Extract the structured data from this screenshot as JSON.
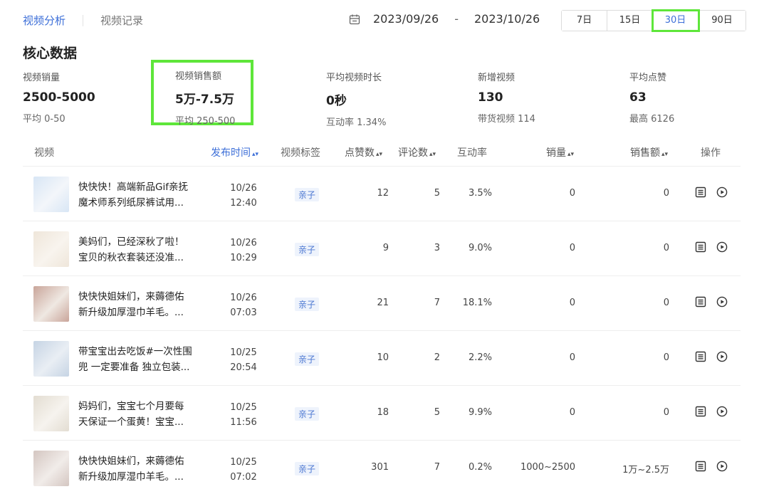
{
  "tabs": [
    {
      "label": "视频分析",
      "active": true
    },
    {
      "label": "视频记录",
      "active": false
    }
  ],
  "date_range": {
    "start": "2023/09/26",
    "separator": "-",
    "end": "2023/10/26"
  },
  "range_buttons": [
    {
      "label": "7日",
      "active": false
    },
    {
      "label": "15日",
      "active": false
    },
    {
      "label": "30日",
      "active": true
    },
    {
      "label": "90日",
      "active": false
    }
  ],
  "section_title": "核心数据",
  "metrics": [
    {
      "label": "视频销量",
      "value": "2500-5000",
      "sub": "平均 0-50"
    },
    {
      "label": "视频销售额",
      "value": "5万-7.5万",
      "sub": "平均 250-500"
    },
    {
      "label": "平均视频时长",
      "value": "0秒",
      "sub": "互动率 1.34%"
    },
    {
      "label": "新增视频",
      "value": "130",
      "sub": "带货视频 114"
    },
    {
      "label": "平均点赞",
      "value": "63",
      "sub": "最高 6126"
    }
  ],
  "table": {
    "headers": {
      "video": "视频",
      "publish_time": "发布时间",
      "tag": "视频标签",
      "likes": "点赞数",
      "comments": "评论数",
      "engagement": "互动率",
      "sales": "销量",
      "revenue": "销售额",
      "actions": "操作"
    },
    "rows": [
      {
        "title1": "快快快！高端新品Gif亲抚",
        "title2": "魔术师系列纸尿裤试用...",
        "date": "10/26",
        "time": "12:40",
        "tag": "亲子",
        "likes": "12",
        "comments": "5",
        "engagement": "3.5%",
        "sales": "0",
        "revenue": "0"
      },
      {
        "title1": "美妈们，已经深秋了啦！",
        "title2": "宝贝的秋衣套装还没准...",
        "date": "10/26",
        "time": "10:29",
        "tag": "亲子",
        "likes": "9",
        "comments": "3",
        "engagement": "9.0%",
        "sales": "0",
        "revenue": "0"
      },
      {
        "title1": "快快快姐妹们，来薅德佑",
        "title2": "新升级加厚湿巾羊毛。...",
        "date": "10/26",
        "time": "07:03",
        "tag": "亲子",
        "likes": "21",
        "comments": "7",
        "engagement": "18.1%",
        "sales": "0",
        "revenue": "0"
      },
      {
        "title1": "带宝宝出去吃饭#一次性围",
        "title2": "兜 一定要准备 独立包装...",
        "date": "10/25",
        "time": "20:54",
        "tag": "亲子",
        "likes": "10",
        "comments": "2",
        "engagement": "2.2%",
        "sales": "0",
        "revenue": "0"
      },
      {
        "title1": "妈妈们，宝宝七个月要每",
        "title2": "天保证一个蛋黄！宝宝...",
        "date": "10/25",
        "time": "11:56",
        "tag": "亲子",
        "likes": "18",
        "comments": "5",
        "engagement": "9.9%",
        "sales": "0",
        "revenue": "0"
      },
      {
        "title1": "快快快姐妹们，来薅德佑",
        "title2": "新升级加厚湿巾羊毛。...",
        "date": "10/25",
        "time": "07:02",
        "tag": "亲子",
        "likes": "301",
        "comments": "7",
        "engagement": "0.2%",
        "sales": "1000~2500",
        "revenue": "1万~2.5万"
      }
    ]
  }
}
